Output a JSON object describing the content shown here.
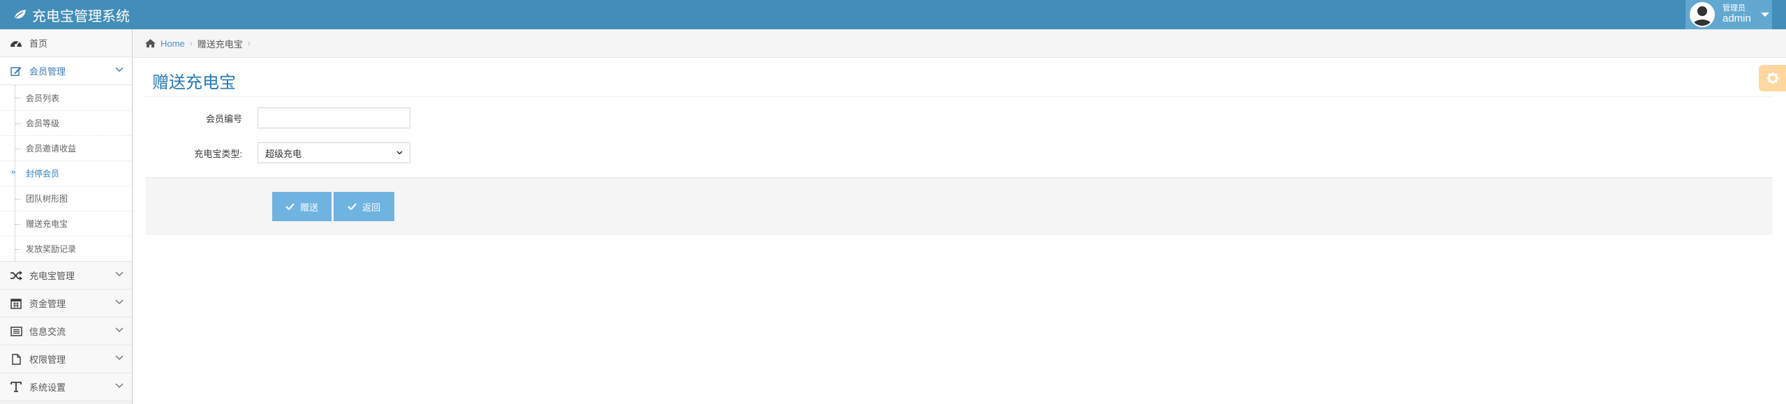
{
  "app": {
    "title": "充电宝管理系统"
  },
  "user": {
    "role": "管理员",
    "name": "admin"
  },
  "sidebar": {
    "items": [
      {
        "label": "首页",
        "icon": "dashboard-icon"
      },
      {
        "label": "会员管理",
        "icon": "edit-icon",
        "open": true,
        "children": [
          {
            "label": "会员列表"
          },
          {
            "label": "会员等级"
          },
          {
            "label": "会员邀请收益"
          },
          {
            "label": "封停会员",
            "active": true
          },
          {
            "label": "团队树形图"
          },
          {
            "label": "赠送充电宝"
          },
          {
            "label": "发放奖励记录"
          }
        ]
      },
      {
        "label": "充电宝管理",
        "icon": "shuffle-icon"
      },
      {
        "label": "资金管理",
        "icon": "calendar-icon"
      },
      {
        "label": "信息交流",
        "icon": "list-alt-icon"
      },
      {
        "label": "权限管理",
        "icon": "file-icon"
      },
      {
        "label": "系统设置",
        "icon": "text-icon"
      }
    ],
    "active_marker": "»"
  },
  "breadcrumb": {
    "home": "Home",
    "current": "赠送充电宝",
    "separator": "›"
  },
  "page": {
    "title": "赠送充电宝"
  },
  "form": {
    "member_id": {
      "label": "会员编号",
      "value": "",
      "placeholder": ""
    },
    "type": {
      "label": "充电宝类型:",
      "selected": "超级充电"
    }
  },
  "actions": {
    "submit_label": "赠送",
    "back_label": "返回"
  },
  "colors": {
    "navbar": "#438eb9",
    "accent": "#2679b5",
    "button": "#6fb3e0",
    "settings": "#ffb752"
  }
}
